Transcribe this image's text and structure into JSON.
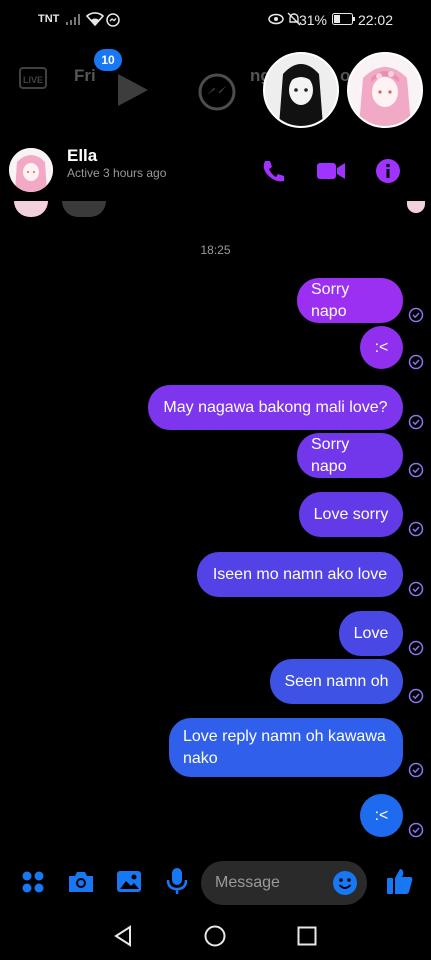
{
  "status_bar": {
    "carrier": "TNT",
    "battery": "31%",
    "time": "22:02"
  },
  "overlay": {
    "badge_count": "10",
    "bg_label_1": "Fri",
    "bg_label_2": "ng",
    "bg_label_3": "o"
  },
  "header": {
    "name": "Ella",
    "status": "Active 3 hours ago"
  },
  "chat": {
    "timestamp": "18:25",
    "messages": [
      "Sorry napo",
      ":<",
      "May nagawa bakong mali love?",
      "Sorry napo",
      "Love sorry",
      "Iseen mo namn ako love",
      "Love",
      "Seen namn oh",
      "Love reply namn oh kawawa nako",
      ":<"
    ]
  },
  "composer": {
    "placeholder": "Message"
  },
  "colors": {
    "accent": "#a033ff",
    "bubble_top": "#8a2be2",
    "bubble_bottom": "#1a73e8",
    "toolbar_icon": "#1877f2"
  }
}
